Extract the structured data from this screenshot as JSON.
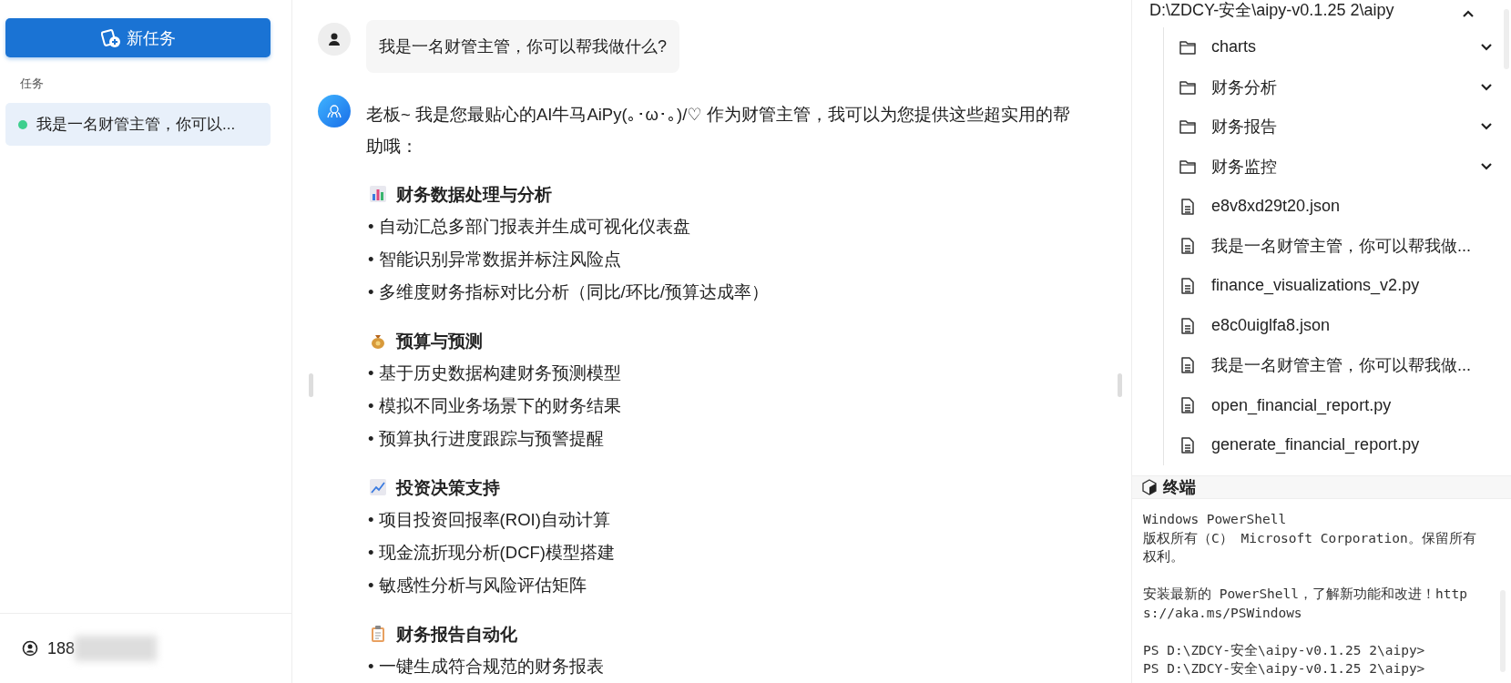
{
  "sidebar": {
    "new_task_button": "新任务",
    "section_label": "任务",
    "tasks": [
      {
        "title": "我是一名财管主管，你可以...",
        "color": "#3ecf8e",
        "selected": true
      }
    ],
    "user": {
      "account": "188"
    }
  },
  "chat": {
    "messages": [
      {
        "kind": "user",
        "text": "我是一名财管主管，你可以帮我做什么?"
      },
      {
        "kind": "assistant",
        "intro": "老板~ 我是您最贴心的AI牛马AiPy(｡･ω･｡)/♡ 作为财管主管，我可以为您提供这些超实用的帮助哦：",
        "sections": [
          {
            "kind": "bars",
            "heading": "财务数据处理与分析",
            "bullets": [
              "• 自动汇总多部门报表并生成可视化仪表盘",
              "• 智能识别异常数据并标注风险点",
              "• 多维度财务指标对比分析（同比/环比/预算达成率）"
            ]
          },
          {
            "kind": "bag",
            "heading": "预算与预测",
            "bullets": [
              "• 基于历史数据构建财务预测模型",
              "• 模拟不同业务场景下的财务结果",
              "• 预算执行进度跟踪与预警提醒"
            ]
          },
          {
            "kind": "trend",
            "heading": "投资决策支持",
            "bullets": [
              "• 项目投资回报率(ROI)自动计算",
              "• 现金流折现分析(DCF)模型搭建",
              "• 敏感性分析与风险评估矩阵"
            ]
          },
          {
            "kind": "clipboard",
            "heading": "财务报告自动化",
            "bullets": [
              "• 一键生成符合规范的财务报表"
            ]
          }
        ]
      }
    ]
  },
  "files": {
    "root": {
      "name": "D:\\ZDCY-安全\\aipy-v0.1.25 2\\aipy",
      "expanded": true,
      "children": [
        {
          "kind": "folder",
          "name": "charts",
          "expanded": false
        },
        {
          "kind": "folder",
          "name": "财务分析",
          "expanded": false
        },
        {
          "kind": "folder",
          "name": "财务报告",
          "expanded": false
        },
        {
          "kind": "folder",
          "name": "财务监控",
          "expanded": false
        },
        {
          "kind": "file",
          "name": "e8v8xd29t20.json"
        },
        {
          "kind": "file",
          "name": "我是一名财管主管，你可以帮我做..."
        },
        {
          "kind": "file",
          "name": "finance_visualizations_v2.py"
        },
        {
          "kind": "file",
          "name": "e8c0uiglfa8.json"
        },
        {
          "kind": "file",
          "name": "我是一名财管主管，你可以帮我做..."
        },
        {
          "kind": "file",
          "name": "open_financial_report.py"
        },
        {
          "kind": "file",
          "name": "generate_financial_report.py"
        }
      ]
    }
  },
  "terminal": {
    "title": "终端",
    "paragraphs": [
      [
        "Windows PowerShell",
        "版权所有（C） Microsoft Corporation。保留所有",
        "权利。"
      ],
      [
        "安装最新的 PowerShell，了解新功能和改进！http",
        "s://aka.ms/PSWindows"
      ],
      [
        "PS D:\\ZDCY-安全\\aipy-v0.1.25 2\\aipy>",
        "PS D:\\ZDCY-安全\\aipy-v0.1.25 2\\aipy>"
      ]
    ]
  }
}
